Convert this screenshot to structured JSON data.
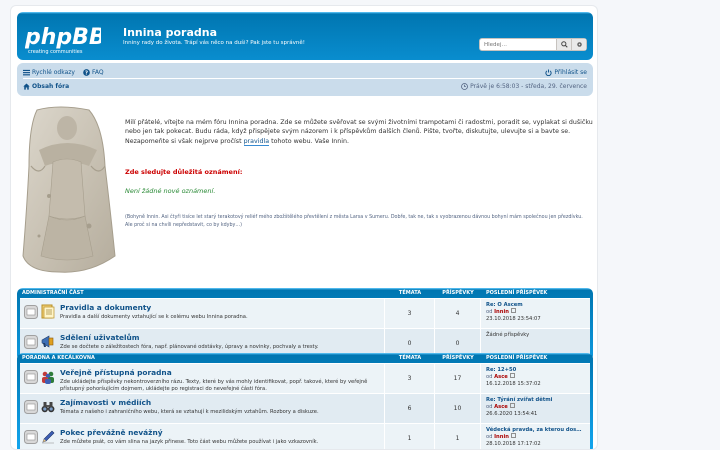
{
  "header": {
    "logo_text": "phpBB",
    "logo_tagline": "creating communities",
    "site_title": "Innina poradna",
    "site_description": "Inniny rady do života. Trápí vás něco na duši? Pak jste tu správně!",
    "search_placeholder": "Hledej…"
  },
  "navbar": {
    "quick_links": "Rychlé odkazy",
    "faq": "FAQ",
    "login": "Přihlásit se",
    "board_index": "Obsah fóra",
    "datetime": "Právě je 6:58:03 - středa, 29. července"
  },
  "intro": {
    "text_before_link": "Milí přátelé, vítejte na mém fóru Innina poradna. Zde se můžete svěřovat se svými životními trampotami či radostmi, poradit se, vyplakat si dušičku nebo jen tak pokecat. Budu ráda, když přispějete svým názorem i k příspěvkům dalších členů. Pište, tvořte, diskutujte, ulevujte si a bavte se. Nezapomeňte si však nejprve pročíst ",
    "link_text": "pravidla",
    "text_after_link": " tohoto webu. Vaše Innin.",
    "notice_title": "Zde sledujte důležitá oznámení:",
    "notice_empty": "Není žádné nové oznámení.",
    "small_note": "(Bohyně Innin. Asi čtyři tisíce let starý terakotový reliéf mého zbožštělého převtělení z města Larsa v Sumeru. Dobře, tak ne, tak s vyobrazenou dávnou bohyní mám společnou jen přezdívku. Ale proč si na chvíli nepředstavit, co by kdyby…)"
  },
  "columns": {
    "topics": "Témata",
    "posts": "Příspěvky",
    "last_post": "Poslední příspěvek"
  },
  "categories": [
    {
      "name": "Administrační část",
      "forums": [
        {
          "title": "Pravidla a dokumenty",
          "desc": "Pravidla a další dokumenty vztahující se k celému webu Innina poradna.",
          "topics": "3",
          "posts": "4",
          "last_title": "Re: O Ascem",
          "last_by": "od",
          "last_author": "Innin",
          "last_date": "23.10.2018 23:54:07",
          "icon": "documents-icon"
        },
        {
          "title": "Sdělení uživatelům",
          "desc": "Zde se dočtete o záležitostech fóra, např. plánované odstávky, úpravy a novinky, pochvaly a tresty.",
          "topics": "0",
          "posts": "0",
          "last_title": "Žádné příspěvky",
          "last_by": "",
          "last_author": "",
          "last_date": "",
          "icon": "megaphone-icon"
        }
      ]
    },
    {
      "name": "Poradna a kecálkovna",
      "forums": [
        {
          "title": "Veřejně přístupná poradna",
          "desc": "Zde ukládejte příspěvky nekontroverzního rázu. Texty, které by vás mohly identifikovat, popř. takové, které by veřejně přístupný pohoršujícím dojmem, ukládejte po registraci do neveřejné části fóra.",
          "topics": "3",
          "posts": "17",
          "last_title": "Re: 12+50",
          "last_by": "od",
          "last_author": "Asce",
          "last_date": "16.12.2018 15:37:02",
          "icon": "people-icon"
        },
        {
          "title": "Zajímavosti v médiích",
          "desc": "Témata z našeho i zahraničního webu, která se vztahují k mezilidským vztahům. Rozbory a diskuze.",
          "topics": "6",
          "posts": "10",
          "last_title": "Re: Týrání zvířat dětmi",
          "last_by": "od",
          "last_author": "Asce",
          "last_date": "26.6.2020 13:54:41",
          "icon": "binoculars-icon"
        },
        {
          "title": "Pokec převážně nevážný",
          "desc": "Zde můžete psát, co vám slina na jazyk přinese. Toto část webu můžete používat i jako vzkazovník.",
          "topics": "1",
          "posts": "1",
          "last_title": "Vědecká pravda, za kterou dos…",
          "last_by": "od",
          "last_author": "Innin",
          "last_date": "28.10.2018 17:17:02",
          "icon": "pen-icon"
        }
      ]
    }
  ],
  "colors": {
    "header_blue": "#12a3eb",
    "nav_bg": "#cadceb",
    "link": "#105289",
    "admin_author": "#aa0000",
    "notice_red": "#cc0000",
    "notice_green": "#2a8a36"
  }
}
